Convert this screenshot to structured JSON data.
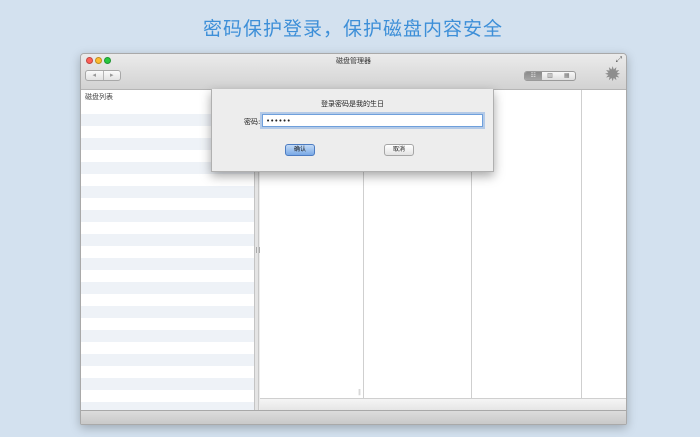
{
  "banner": {
    "text": "密码保护登录，保护磁盘内容安全",
    "color": "#3d8fd8"
  },
  "window": {
    "title": "磁盘管理器",
    "nav": {
      "back": "◂",
      "forward": "▸"
    },
    "view_switch": [
      "☷",
      "▥",
      "▦"
    ]
  },
  "sidebar": {
    "header": "磁盘列表"
  },
  "dialog": {
    "title": "登录密码是我的生日",
    "password_label": "密码:",
    "password_value": "••••••",
    "ok_label": "确认",
    "cancel_label": "取消",
    "accent": "#79a9e6"
  }
}
